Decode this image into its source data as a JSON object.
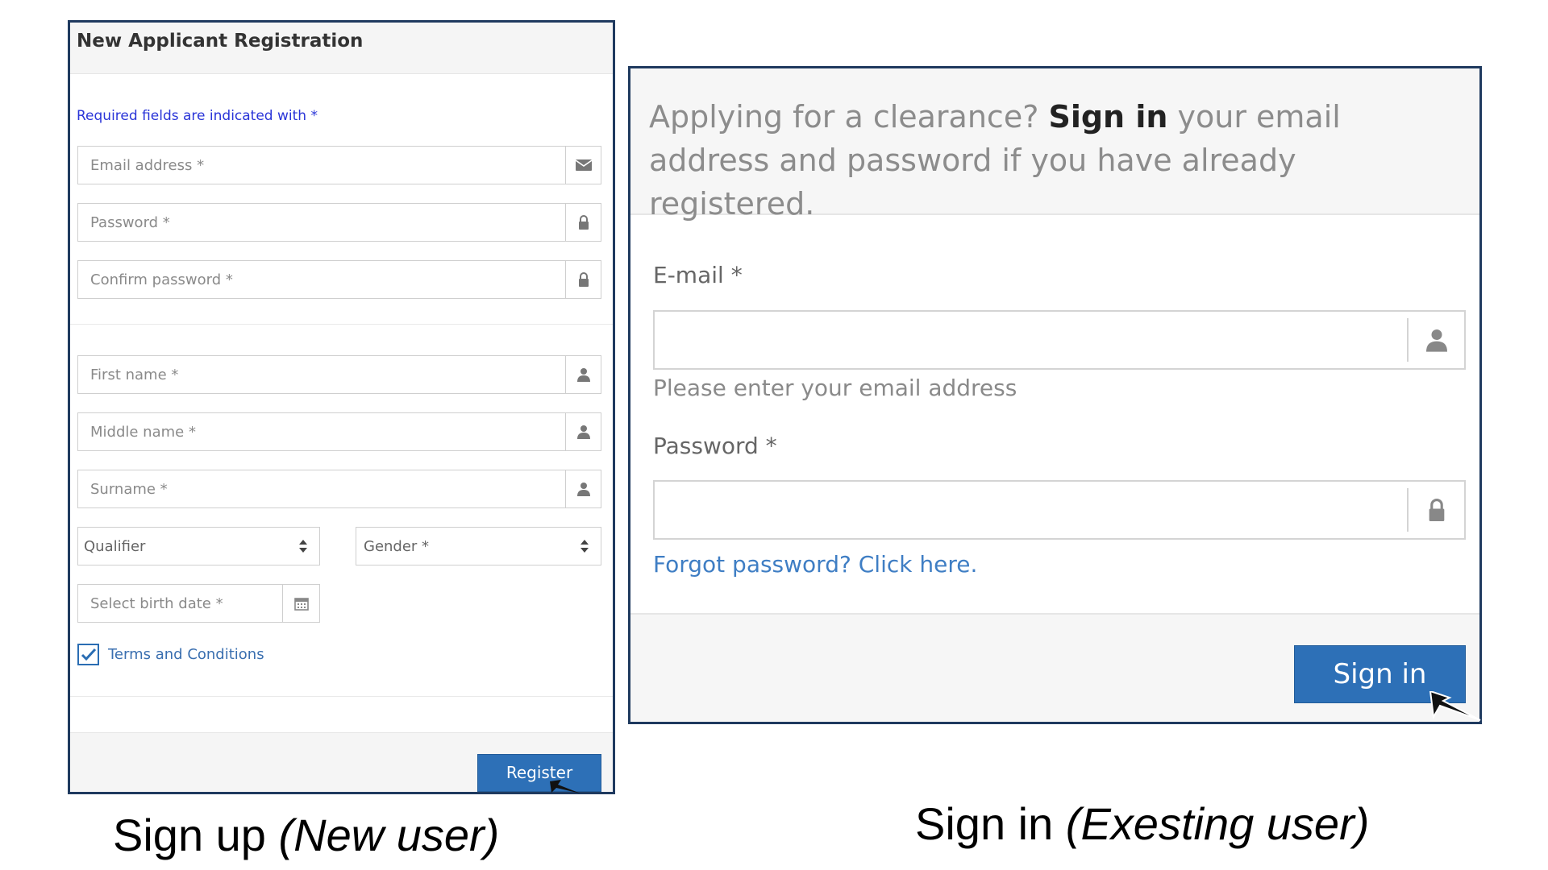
{
  "register_panel": {
    "title": "New Applicant Registration",
    "required_note": "Required fields are indicated with *",
    "fields": {
      "email": "Email address *",
      "password": "Password *",
      "confirm_password": "Confirm password *",
      "first_name": "First name *",
      "middle_name": "Middle name *",
      "surname": "Surname *",
      "qualifier": "Qualifier",
      "gender": "Gender *",
      "birth_date": "Select birth date *"
    },
    "terms_label": "Terms and Conditions",
    "terms_checked": true,
    "register_button": "Register",
    "icons": {
      "email": "envelope-icon",
      "password": "lock-icon",
      "person": "user-icon",
      "date": "calendar-icon",
      "select": "updown-caret-icon"
    }
  },
  "signin_panel": {
    "heading_pre": "Applying for a clearance? ",
    "heading_bold": "Sign in",
    "heading_post": " your email address and password if you have already registered.",
    "email_label": "E-mail *",
    "email_help": "Please enter your email address",
    "password_label": "Password *",
    "forgot_link": "Forgot password? Click here.",
    "signin_button": "Sign in",
    "icons": {
      "email": "user-icon",
      "password": "lock-icon"
    }
  },
  "captions": {
    "signup_plain": "Sign up ",
    "signup_italic": "(New user)",
    "signin_plain": "Sign in ",
    "signin_italic": "(Exesting user)"
  },
  "colors": {
    "panel_border": "#1f3a5f",
    "primary_button": "#2d70b7",
    "link": "#3f7ec4",
    "required_note": "#2a35d8"
  }
}
